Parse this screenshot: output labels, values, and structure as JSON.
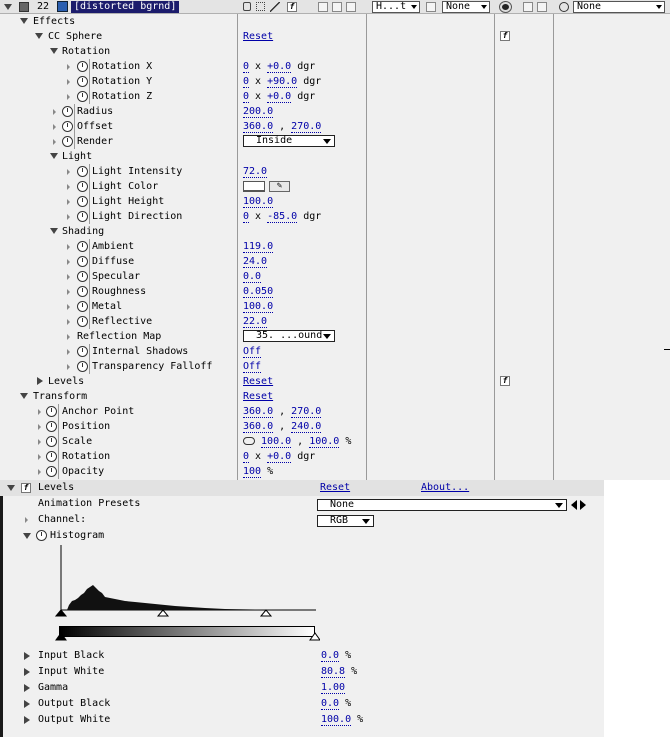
{
  "timeline": {
    "layer_number": "22",
    "layer_name": "[distorted bgrnd]",
    "mode_dropdown": "H...t",
    "trkmat_dropdown": "None",
    "parent_dropdown": "None",
    "cc_sphere": {
      "effects_label": "Effects",
      "name": "CC Sphere",
      "reset": "Reset",
      "rotation_group": "Rotation",
      "rotation_x": {
        "label": "Rotation X",
        "rev": "0",
        "deg": "+0.0",
        "unit": "dgr"
      },
      "rotation_y": {
        "label": "Rotation Y",
        "rev": "0",
        "deg": "+90.0",
        "unit": "dgr"
      },
      "rotation_z": {
        "label": "Rotation Z",
        "rev": "0",
        "deg": "+0.0",
        "unit": "dgr"
      },
      "radius": {
        "label": "Radius",
        "value": "200.0"
      },
      "offset": {
        "label": "Offset",
        "x": "360.0",
        "y": "270.0"
      },
      "render": {
        "label": "Render",
        "value": "Inside"
      },
      "light_group": "Light",
      "light_intensity": {
        "label": "Light Intensity",
        "value": "72.0"
      },
      "light_color": {
        "label": "Light Color"
      },
      "light_height": {
        "label": "Light Height",
        "value": "100.0"
      },
      "light_direction": {
        "label": "Light Direction",
        "rev": "0",
        "deg": "-85.0",
        "unit": "dgr"
      },
      "shading_group": "Shading",
      "ambient": {
        "label": "Ambient",
        "value": "119.0"
      },
      "diffuse": {
        "label": "Diffuse",
        "value": "24.0"
      },
      "specular": {
        "label": "Specular",
        "value": "0.0"
      },
      "roughness": {
        "label": "Roughness",
        "value": "0.050"
      },
      "metal": {
        "label": "Metal",
        "value": "100.0"
      },
      "reflective": {
        "label": "Reflective",
        "value": "22.0"
      },
      "reflection_map": {
        "label": "Reflection Map",
        "value": "35. ...ound"
      },
      "internal_shadows": {
        "label": "Internal Shadows",
        "value": "Off"
      },
      "transparency_falloff": {
        "label": "Transparency Falloff",
        "value": "Off"
      }
    },
    "levels": {
      "label": "Levels",
      "reset": "Reset"
    },
    "transform": {
      "label": "Transform",
      "reset": "Reset",
      "anchor_point": {
        "label": "Anchor Point",
        "x": "360.0",
        "y": "270.0"
      },
      "position": {
        "label": "Position",
        "x": "360.0",
        "y": "240.0"
      },
      "scale": {
        "label": "Scale",
        "x": "100.0",
        "y": "100.0",
        "unit": "%"
      },
      "rotation": {
        "label": "Rotation",
        "rev": "0",
        "deg": "+0.0",
        "unit": "dgr"
      },
      "opacity": {
        "label": "Opacity",
        "value": "100",
        "unit": "%"
      }
    }
  },
  "effect_controls": {
    "title": "Levels",
    "reset": "Reset",
    "about": "About...",
    "animation_presets": {
      "label": "Animation Presets",
      "value": "None"
    },
    "channel": {
      "label": "Channel:",
      "value": "RGB"
    },
    "histogram_label": "Histogram",
    "params": [
      {
        "label": "Input Black",
        "value": "0.0",
        "unit": "%"
      },
      {
        "label": "Input White",
        "value": "80.8",
        "unit": "%"
      },
      {
        "label": "Gamma",
        "value": "1.00",
        "unit": ""
      },
      {
        "label": "Output Black",
        "value": "0.0",
        "unit": "%"
      },
      {
        "label": "Output White",
        "value": "100.0",
        "unit": "%"
      }
    ]
  },
  "colors": {
    "selection": "#1c1c6c",
    "link": "#0000a8",
    "panel": "#f0f0f0"
  }
}
